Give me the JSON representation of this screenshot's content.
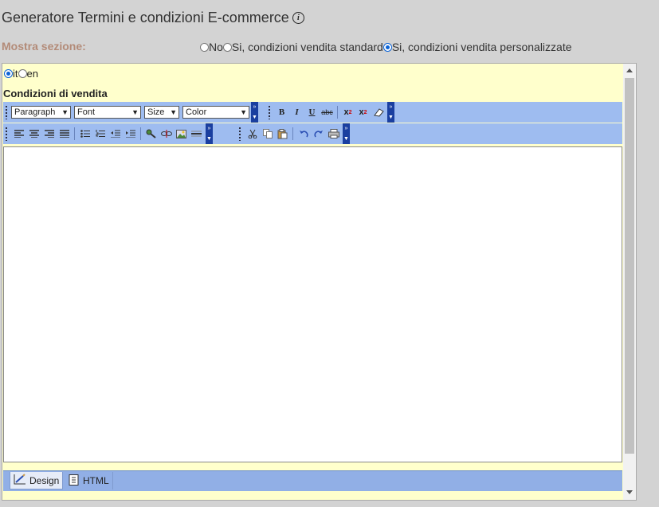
{
  "header": {
    "title": "Generatore Termini e condizioni E-commerce",
    "info_icon": "info-icon"
  },
  "mostra": {
    "label": "Mostra sezione:",
    "options": [
      {
        "label": "No",
        "checked": false
      },
      {
        "label": "Si, condizioni vendita standard",
        "checked": false
      },
      {
        "label": "Si, condizioni vendita personalizzate",
        "checked": true
      }
    ]
  },
  "lang": {
    "options": [
      {
        "label": "it",
        "checked": true
      },
      {
        "label": "en",
        "checked": false
      }
    ]
  },
  "editor": {
    "label": "Condizioni di vendita",
    "content": "",
    "toolbar": {
      "paragraph": "Paragraph",
      "font": "Font",
      "size": "Size",
      "color": "Color",
      "buttons_row1": [
        "bold-icon",
        "italic-icon",
        "underline-icon",
        "strikethrough-icon",
        "superscript-icon",
        "subscript-icon",
        "eraser-icon"
      ],
      "buttons_row2": [
        "align-left-icon",
        "align-center-icon",
        "align-right-icon",
        "align-justify-icon",
        "bullet-list-icon",
        "numbered-list-icon",
        "outdent-icon",
        "indent-icon",
        "link-icon",
        "unlink-icon",
        "image-icon",
        "horizontal-rule-icon",
        "cut-icon",
        "copy-icon",
        "paste-icon",
        "undo-icon",
        "redo-icon",
        "print-icon"
      ]
    },
    "tabs": {
      "design": "Design",
      "html": "HTML"
    }
  }
}
